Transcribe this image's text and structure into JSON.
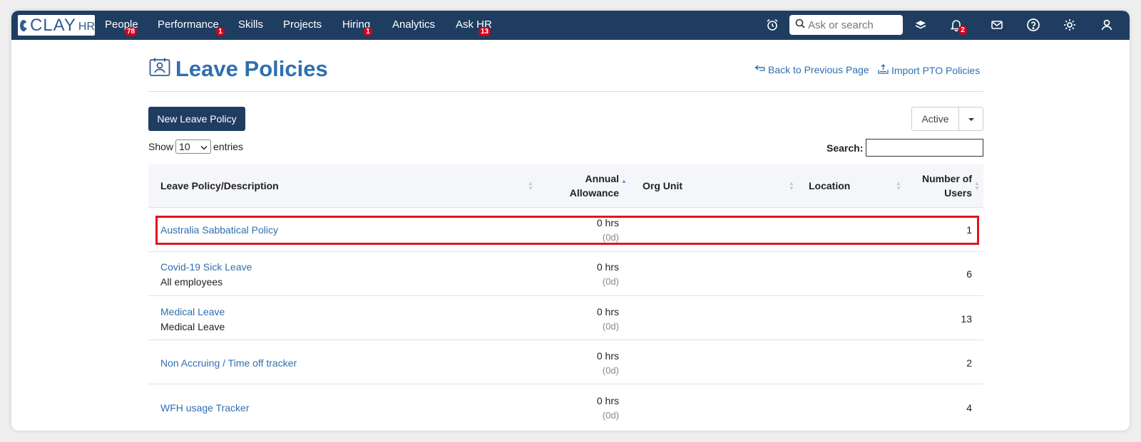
{
  "nav": {
    "logo_text": "CLAY",
    "logo_suffix": "HR",
    "items": [
      {
        "label": "People",
        "badge": "78"
      },
      {
        "label": "Performance",
        "badge": "1"
      },
      {
        "label": "Skills",
        "badge": ""
      },
      {
        "label": "Projects",
        "badge": ""
      },
      {
        "label": "Hiring",
        "badge": "1"
      },
      {
        "label": "Analytics",
        "badge": ""
      },
      {
        "label": "Ask HR",
        "badge": "13"
      }
    ],
    "search_placeholder": "Ask or search",
    "notifications_badge": "2",
    "icons": [
      "alarm-clock-icon",
      "search-icon",
      "layers-icon",
      "bell-icon",
      "mail-icon",
      "help-icon",
      "gear-icon",
      "user-icon"
    ],
    "color": "#1f3d61"
  },
  "page": {
    "title": "Leave Policies",
    "back_link": "Back to Previous Page",
    "import_link": "Import PTO Policies",
    "new_button": "New Leave Policy",
    "status_filter": "Active",
    "show_label": "Show",
    "entries_value": "10",
    "entries_label": "entries",
    "search_label": "Search:",
    "accent_color": "#2f6fb0"
  },
  "table": {
    "columns": [
      "Leave Policy/Description",
      "Annual Allowance",
      "Org Unit",
      "Location",
      "Number of Users"
    ],
    "annual_line1": "Annual",
    "annual_line2": "Allowance",
    "users_line1": "Number of",
    "users_line2": "Users",
    "rows": [
      {
        "name": "Australia Sabbatical Policy",
        "description": "",
        "hours": "0  hrs",
        "days": "(0d)",
        "org_unit": "",
        "location": "",
        "users": "1",
        "highlighted": true
      },
      {
        "name": "Covid-19 Sick Leave",
        "description": "All employees",
        "hours": "0  hrs",
        "days": "(0d)",
        "org_unit": "",
        "location": "",
        "users": "6",
        "highlighted": false
      },
      {
        "name": "Medical Leave",
        "description": "Medical Leave",
        "hours": "0  hrs",
        "days": "(0d)",
        "org_unit": "",
        "location": "",
        "users": "13",
        "highlighted": false
      },
      {
        "name": "Non Accruing / Time off tracker",
        "description": "",
        "hours": "0  hrs",
        "days": "(0d)",
        "org_unit": "",
        "location": "",
        "users": "2",
        "highlighted": false
      },
      {
        "name": "WFH usage Tracker",
        "description": "",
        "hours": "0  hrs",
        "days": "(0d)",
        "org_unit": "",
        "location": "",
        "users": "4",
        "highlighted": false
      }
    ]
  }
}
